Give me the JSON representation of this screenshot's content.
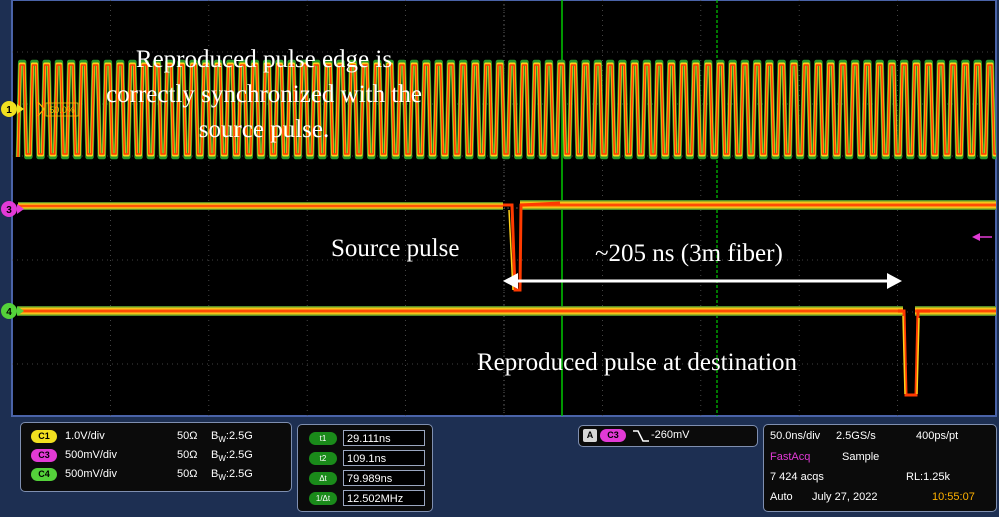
{
  "annotations": {
    "sync_line1": "Reproduced pulse edge is",
    "sync_line2": "correctly synchronized with the",
    "sync_line3": "source pulse.",
    "source": "Source pulse",
    "delay": "~205 ns (3m fiber)",
    "dest": "Reproduced pulse at destination"
  },
  "markers": {
    "ch1": "1",
    "ch3": "3",
    "ch4": "4",
    "trigger_level": "50.0%"
  },
  "channels": [
    {
      "tag": "C1",
      "scale": "1.0V/div",
      "imp": "50Ω",
      "bw": "2.5G",
      "color": "#f2e020"
    },
    {
      "tag": "C3",
      "scale": "500mV/div",
      "imp": "50Ω",
      "bw": "2.5G",
      "color": "#e23ad6"
    },
    {
      "tag": "C4",
      "scale": "500mV/div",
      "imp": "50Ω",
      "bw": "2.5G",
      "color": "#54d23a"
    }
  ],
  "bw_prefix": "B",
  "bw_sub": "W",
  "cursors": [
    {
      "label": "t1",
      "value": "29.111ns"
    },
    {
      "label": "t2",
      "value": "109.1ns"
    },
    {
      "label": "Δt",
      "value": "79.989ns"
    },
    {
      "label": "1/Δt",
      "value": "12.502MHz"
    }
  ],
  "trigger": {
    "mode": "A",
    "source": "C3",
    "slope_icon": "falling-edge",
    "level": "-260mV"
  },
  "acquisition": {
    "timebase": "50.0ns/div",
    "rate": "2.5GS/s",
    "resolution": "400ps/pt",
    "mode": "FastAcq",
    "sample": "Sample",
    "acqs": "7 424 acqs",
    "record": "RL:1.25k",
    "run": "Auto",
    "date": "July 27, 2022",
    "time": "10:55:07"
  },
  "colors": {
    "accent_orange": "#ffb200",
    "fastacq_pink": "#e23ad6",
    "green_cursor": "#00c800"
  }
}
